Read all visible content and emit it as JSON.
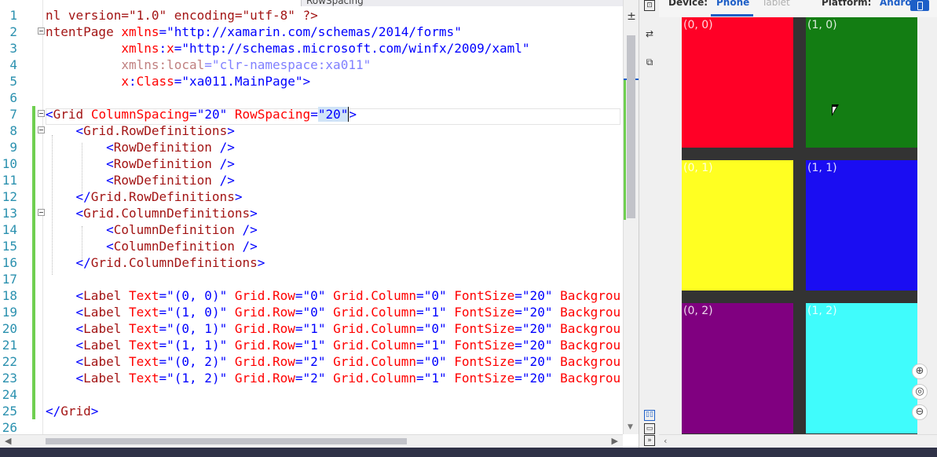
{
  "editor": {
    "tab_label": "RowSpacing",
    "lines": [
      {
        "n": "1",
        "segs": [
          [
            "t",
            "nl version=\"1.0\" encoding=\"utf-8\" ?>"
          ]
        ]
      },
      {
        "n": "2",
        "segs": [
          [
            "t",
            "ntentPage "
          ],
          [
            "a",
            "xmlns"
          ],
          [
            "k",
            "="
          ],
          [
            "s",
            "\"http://xamarin.com/schemas/2014/forms\""
          ]
        ]
      },
      {
        "n": "3",
        "segs": [
          [
            "x",
            "          "
          ],
          [
            "a",
            "xmlns"
          ],
          [
            "k",
            ":"
          ],
          [
            "a",
            "x"
          ],
          [
            "k",
            "="
          ],
          [
            "s",
            "\"http://schemas.microsoft.com/winfx/2009/xaml\""
          ]
        ]
      },
      {
        "n": "4",
        "segs": [
          [
            "x",
            "          "
          ],
          [
            "dim",
            "xmlns"
          ],
          [
            "dim",
            ":local"
          ],
          [
            "dim2",
            "=\"clr-namespace:xa011\""
          ]
        ]
      },
      {
        "n": "5",
        "segs": [
          [
            "x",
            "          "
          ],
          [
            "a",
            "x"
          ],
          [
            "k",
            ":"
          ],
          [
            "a",
            "Class"
          ],
          [
            "k",
            "="
          ],
          [
            "s",
            "\"xa011.MainPage\""
          ],
          [
            "k",
            ">"
          ]
        ]
      },
      {
        "n": "6",
        "segs": []
      },
      {
        "n": "7",
        "segs": [
          [
            "k",
            "<"
          ],
          [
            "t",
            "Grid "
          ],
          [
            "a",
            "ColumnSpacing"
          ],
          [
            "k",
            "="
          ],
          [
            "s",
            "\"20\" "
          ],
          [
            "a",
            "RowSpacing"
          ],
          [
            "k",
            "="
          ],
          [
            "sel",
            "\"20\""
          ],
          [
            "k",
            ">"
          ]
        ]
      },
      {
        "n": "8",
        "segs": [
          [
            "x",
            "    "
          ],
          [
            "k",
            "<"
          ],
          [
            "t",
            "Grid.RowDefinitions"
          ],
          [
            "k",
            ">"
          ]
        ]
      },
      {
        "n": "9",
        "segs": [
          [
            "x",
            "        "
          ],
          [
            "k",
            "<"
          ],
          [
            "t",
            "RowDefinition "
          ],
          [
            "k",
            "/>"
          ]
        ]
      },
      {
        "n": "10",
        "segs": [
          [
            "x",
            "        "
          ],
          [
            "k",
            "<"
          ],
          [
            "t",
            "RowDefinition "
          ],
          [
            "k",
            "/>"
          ]
        ]
      },
      {
        "n": "11",
        "segs": [
          [
            "x",
            "        "
          ],
          [
            "k",
            "<"
          ],
          [
            "t",
            "RowDefinition "
          ],
          [
            "k",
            "/>"
          ]
        ]
      },
      {
        "n": "12",
        "segs": [
          [
            "x",
            "    "
          ],
          [
            "k",
            "</"
          ],
          [
            "t",
            "Grid.RowDefinitions"
          ],
          [
            "k",
            ">"
          ]
        ]
      },
      {
        "n": "13",
        "segs": [
          [
            "x",
            "    "
          ],
          [
            "k",
            "<"
          ],
          [
            "t",
            "Grid.ColumnDefinitions"
          ],
          [
            "k",
            ">"
          ]
        ]
      },
      {
        "n": "14",
        "segs": [
          [
            "x",
            "        "
          ],
          [
            "k",
            "<"
          ],
          [
            "t",
            "ColumnDefinition "
          ],
          [
            "k",
            "/>"
          ]
        ]
      },
      {
        "n": "15",
        "segs": [
          [
            "x",
            "        "
          ],
          [
            "k",
            "<"
          ],
          [
            "t",
            "ColumnDefinition "
          ],
          [
            "k",
            "/>"
          ]
        ]
      },
      {
        "n": "16",
        "segs": [
          [
            "x",
            "    "
          ],
          [
            "k",
            "</"
          ],
          [
            "t",
            "Grid.ColumnDefinitions"
          ],
          [
            "k",
            ">"
          ]
        ]
      },
      {
        "n": "17",
        "segs": []
      },
      {
        "n": "18",
        "segs": [
          [
            "x",
            "    "
          ],
          [
            "k",
            "<"
          ],
          [
            "t",
            "Label "
          ],
          [
            "a",
            "Text"
          ],
          [
            "k",
            "="
          ],
          [
            "s",
            "\"(0, 0)\" "
          ],
          [
            "a",
            "Grid.Row"
          ],
          [
            "k",
            "="
          ],
          [
            "s",
            "\"0\" "
          ],
          [
            "a",
            "Grid.Column"
          ],
          [
            "k",
            "="
          ],
          [
            "s",
            "\"0\" "
          ],
          [
            "a",
            "FontSize"
          ],
          [
            "k",
            "="
          ],
          [
            "s",
            "\"20\" "
          ],
          [
            "a",
            "Backgrou"
          ]
        ]
      },
      {
        "n": "19",
        "segs": [
          [
            "x",
            "    "
          ],
          [
            "k",
            "<"
          ],
          [
            "t",
            "Label "
          ],
          [
            "a",
            "Text"
          ],
          [
            "k",
            "="
          ],
          [
            "s",
            "\"(1, 0)\" "
          ],
          [
            "a",
            "Grid.Row"
          ],
          [
            "k",
            "="
          ],
          [
            "s",
            "\"0\" "
          ],
          [
            "a",
            "Grid.Column"
          ],
          [
            "k",
            "="
          ],
          [
            "s",
            "\"1\" "
          ],
          [
            "a",
            "FontSize"
          ],
          [
            "k",
            "="
          ],
          [
            "s",
            "\"20\" "
          ],
          [
            "a",
            "Backgrou"
          ]
        ]
      },
      {
        "n": "20",
        "segs": [
          [
            "x",
            "    "
          ],
          [
            "k",
            "<"
          ],
          [
            "t",
            "Label "
          ],
          [
            "a",
            "Text"
          ],
          [
            "k",
            "="
          ],
          [
            "s",
            "\"(0, 1)\" "
          ],
          [
            "a",
            "Grid.Row"
          ],
          [
            "k",
            "="
          ],
          [
            "s",
            "\"1\" "
          ],
          [
            "a",
            "Grid.Column"
          ],
          [
            "k",
            "="
          ],
          [
            "s",
            "\"0\" "
          ],
          [
            "a",
            "FontSize"
          ],
          [
            "k",
            "="
          ],
          [
            "s",
            "\"20\" "
          ],
          [
            "a",
            "Backgrou"
          ]
        ]
      },
      {
        "n": "21",
        "segs": [
          [
            "x",
            "    "
          ],
          [
            "k",
            "<"
          ],
          [
            "t",
            "Label "
          ],
          [
            "a",
            "Text"
          ],
          [
            "k",
            "="
          ],
          [
            "s",
            "\"(1, 1)\" "
          ],
          [
            "a",
            "Grid.Row"
          ],
          [
            "k",
            "="
          ],
          [
            "s",
            "\"1\" "
          ],
          [
            "a",
            "Grid.Column"
          ],
          [
            "k",
            "="
          ],
          [
            "s",
            "\"1\" "
          ],
          [
            "a",
            "FontSize"
          ],
          [
            "k",
            "="
          ],
          [
            "s",
            "\"20\" "
          ],
          [
            "a",
            "Backgrou"
          ]
        ]
      },
      {
        "n": "22",
        "segs": [
          [
            "x",
            "    "
          ],
          [
            "k",
            "<"
          ],
          [
            "t",
            "Label "
          ],
          [
            "a",
            "Text"
          ],
          [
            "k",
            "="
          ],
          [
            "s",
            "\"(0, 2)\" "
          ],
          [
            "a",
            "Grid.Row"
          ],
          [
            "k",
            "="
          ],
          [
            "s",
            "\"2\" "
          ],
          [
            "a",
            "Grid.Column"
          ],
          [
            "k",
            "="
          ],
          [
            "s",
            "\"0\" "
          ],
          [
            "a",
            "FontSize"
          ],
          [
            "k",
            "="
          ],
          [
            "s",
            "\"20\" "
          ],
          [
            "a",
            "Backgrou"
          ]
        ]
      },
      {
        "n": "23",
        "segs": [
          [
            "x",
            "    "
          ],
          [
            "k",
            "<"
          ],
          [
            "t",
            "Label "
          ],
          [
            "a",
            "Text"
          ],
          [
            "k",
            "="
          ],
          [
            "s",
            "\"(1, 2)\" "
          ],
          [
            "a",
            "Grid.Row"
          ],
          [
            "k",
            "="
          ],
          [
            "s",
            "\"2\" "
          ],
          [
            "a",
            "Grid.Column"
          ],
          [
            "k",
            "="
          ],
          [
            "s",
            "\"1\" "
          ],
          [
            "a",
            "FontSize"
          ],
          [
            "k",
            "="
          ],
          [
            "s",
            "\"20\" "
          ],
          [
            "a",
            "Backgrou"
          ]
        ]
      },
      {
        "n": "24",
        "segs": []
      },
      {
        "n": "25",
        "segs": [
          [
            "k",
            "</"
          ],
          [
            "t",
            "Grid"
          ],
          [
            "k",
            ">"
          ]
        ]
      },
      {
        "n": "26",
        "segs": []
      }
    ]
  },
  "preview": {
    "device_label": "Device:",
    "phone_tab": "Phone",
    "tablet_tab": "Tablet",
    "platform_label": "Platform:",
    "platform_value": "Andro",
    "cells": [
      {
        "label": "(0, 0)",
        "color": "#ff0026",
        "row": 0,
        "col": 0
      },
      {
        "label": "(1, 0)",
        "color": "#137d13",
        "row": 0,
        "col": 1
      },
      {
        "label": "(0, 1)",
        "color": "#ffff22",
        "row": 1,
        "col": 0
      },
      {
        "label": "(1, 1)",
        "color": "#1a0df2",
        "row": 1,
        "col": 1
      },
      {
        "label": "(0, 2)",
        "color": "#800080",
        "row": 2,
        "col": 0
      },
      {
        "label": "(1, 2)",
        "color": "#40fcfc",
        "row": 2,
        "col": 1
      }
    ]
  },
  "zoom": {
    "in_icon": "⊕",
    "fit_icon": "◎",
    "out_icon": "⊖"
  }
}
